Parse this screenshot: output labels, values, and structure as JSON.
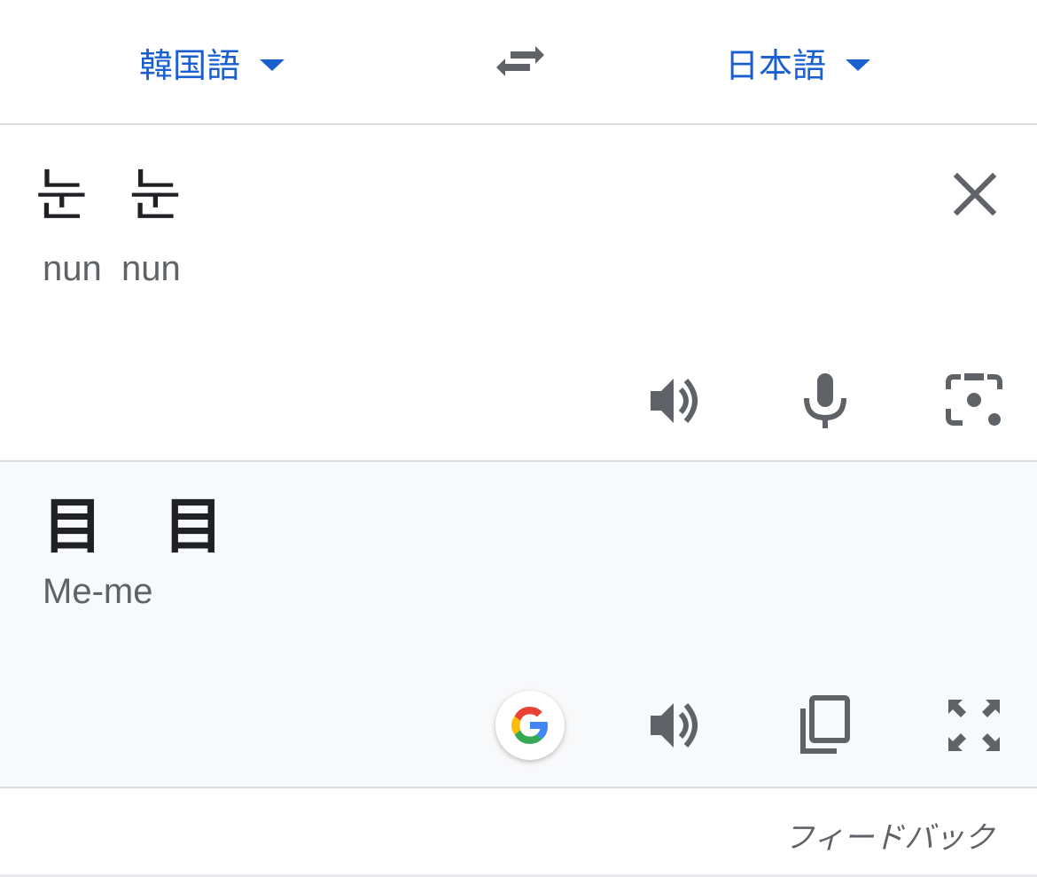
{
  "lang_bar": {
    "source_lang": "韓国語",
    "target_lang": "日本語",
    "swap_icon": "swap-arrows-icon"
  },
  "source": {
    "text": "눈  눈",
    "romanization": "nun  nun",
    "icons": [
      "close-icon",
      "speaker-icon",
      "microphone-icon",
      "camera-lens-icon"
    ]
  },
  "target": {
    "text": "目　目",
    "romanization": "Me-me",
    "icons": [
      "google-logo-icon",
      "speaker-icon",
      "copy-icon",
      "fullscreen-icon"
    ]
  },
  "footer": {
    "feedback_label": "フィードバック"
  },
  "colors": {
    "accent": "#1a5fd0",
    "icon_gray": "#5f6368",
    "panel_bg": "#f8f9fa",
    "divider": "#dadce0"
  }
}
